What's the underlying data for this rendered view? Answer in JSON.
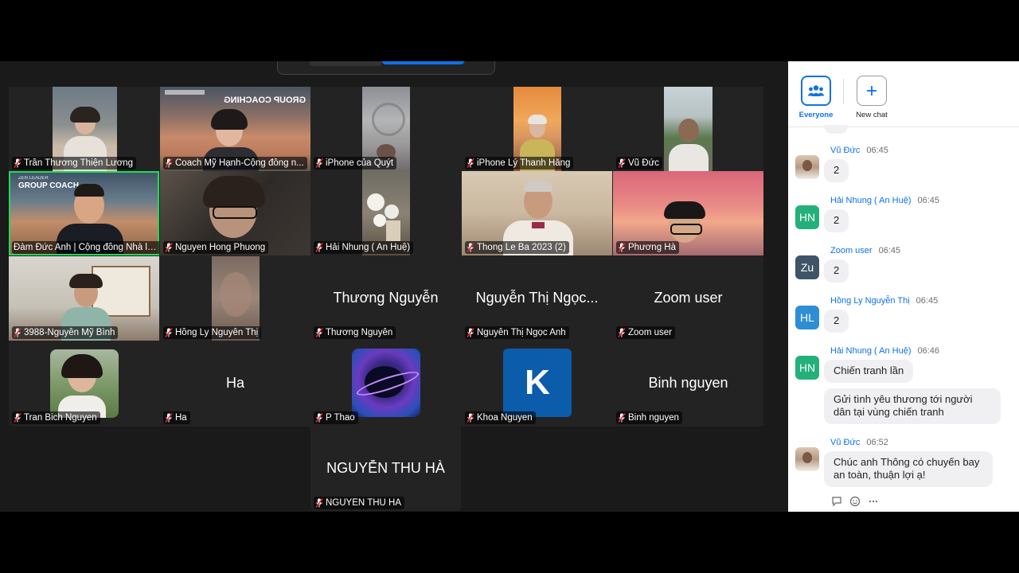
{
  "participants": [
    {
      "name": "Trần Thương Thiện Lương"
    },
    {
      "name": "Coach Mỹ Hạnh-Cộng đồng n..."
    },
    {
      "name": "iPhone của Quýt"
    },
    {
      "name": "iPhone Lý Thanh Hằng"
    },
    {
      "name": "Vũ Đức"
    },
    {
      "name": "Đàm Đức Anh | Cộng đồng Nhà lã..."
    },
    {
      "name": "Nguyen Hong Phuong"
    },
    {
      "name": "Hải Nhung ( An Huệ)"
    },
    {
      "name": "Thong Le Ba 2023 (2)"
    },
    {
      "name": "Phương Hà"
    },
    {
      "name": "3988-Nguyễn Mỹ Bình"
    },
    {
      "name": "Hồng Ly Nguyễn Thị"
    },
    {
      "name": "Thương Nguyễn",
      "display": "Thương Nguyễn"
    },
    {
      "name": "Nguyễn Thị Ngọc Anh",
      "display": "Nguyễn Thị Ngọc..."
    },
    {
      "name": "Zoom user",
      "display": "Zoom user"
    },
    {
      "name": "Tran Bich Nguyen"
    },
    {
      "name": "Ha",
      "display": "Ha"
    },
    {
      "name": "P Thao"
    },
    {
      "name": "Khoa Nguyen",
      "avatar_letter": "K"
    },
    {
      "name": "Binh nguyen",
      "display": "Binh nguyen"
    },
    {
      "name": "NGUYỄN THU HÀ",
      "display": "NGUYỄN THU HÀ"
    }
  ],
  "slides": {
    "tile2_text": "GROUP COACHING",
    "tile6_top": "ZEN LEADER",
    "tile6_text": "GROUP COACH"
  },
  "chat": {
    "tabs": {
      "everyone": "Everyone",
      "new_chat": "New chat"
    },
    "messages": [
      {
        "sender": "Vũ Đức",
        "time": "06:45",
        "text": "2"
      },
      {
        "sender": "Hải Nhung ( An Huệ)",
        "initials": "HN",
        "time": "06:45",
        "text": "2"
      },
      {
        "sender": "Zoom user",
        "initials": "Zu",
        "time": "06:45",
        "text": "2"
      },
      {
        "sender": "Hồng Ly Nguyễn Thị",
        "initials": "HL",
        "time": "06:45",
        "text": "2"
      },
      {
        "sender": "Hải Nhung ( An Huệ)",
        "initials": "HN",
        "time": "06:46",
        "text": "Chiến tranh lần",
        "text2": "Gửi tình yêu thương tới người dân tại vùng chiến tranh"
      },
      {
        "sender": "Vũ Đức",
        "time": "06:52",
        "text": "Chúc anh Thông có chuyến bay an toàn, thuận lợi ạ!"
      }
    ]
  },
  "colors": {
    "accent": "#0e71eb",
    "active_speaker": "#23d959",
    "muted_red": "#e02828",
    "avatar_green": "#23b07a",
    "avatar_slate": "#3f5467",
    "avatar_blue": "#2f8dd6",
    "khoa_bg": "#0b5cab"
  }
}
